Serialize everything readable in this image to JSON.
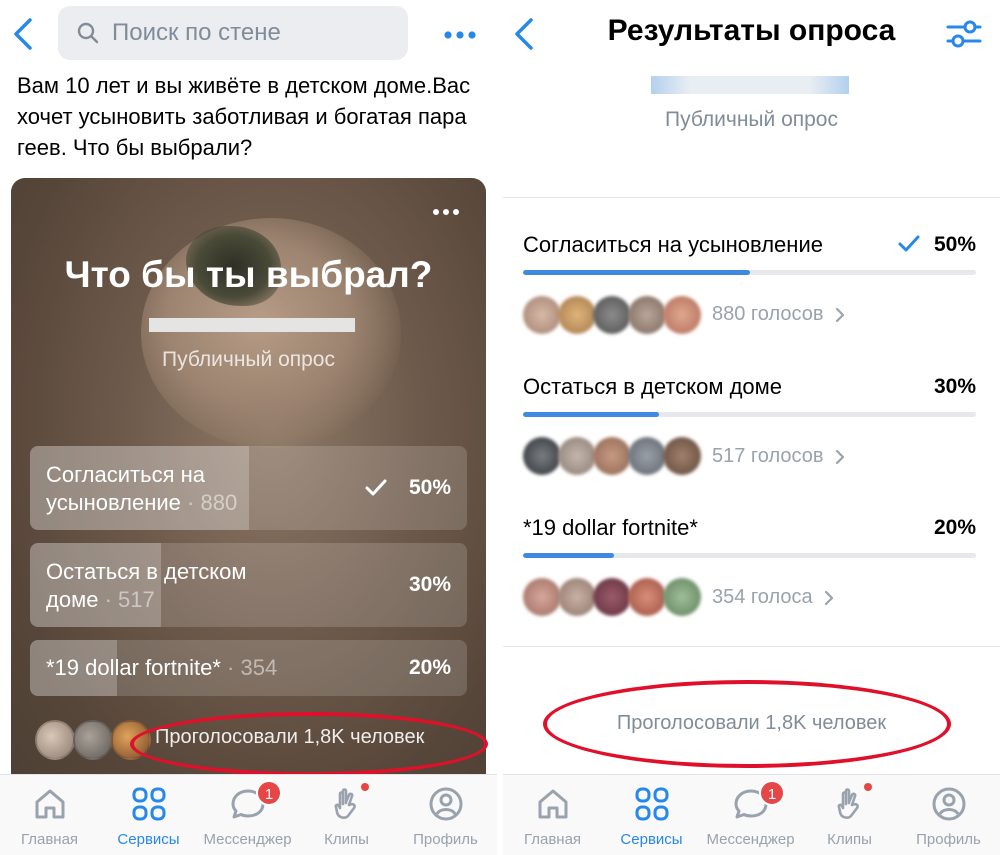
{
  "left_screen": {
    "search": {
      "placeholder": "Поиск по стене"
    },
    "post_text": "Вам 10 лет и вы живёте в детском доме.Вас хочет усыновить заботливая и богатая пара геев. Что бы выбрали?",
    "poll": {
      "title": "Что бы ты выбрал?",
      "type": "Публичный опрос",
      "options": [
        {
          "label": "Согласиться на усыновление",
          "line1": "Согласиться на",
          "line2": "усыновление",
          "count": "880",
          "percent": "50%",
          "share": 0.5,
          "selected": true
        },
        {
          "label": "Остаться в детском доме",
          "line1": "Остаться в детском",
          "line2": "доме",
          "count": "517",
          "percent": "30%",
          "share": 0.3,
          "selected": false
        },
        {
          "label": "*19 dollar fortnite*",
          "count": "354",
          "percent": "20%",
          "share": 0.2,
          "selected": false
        }
      ],
      "voted_total": "Проголосовали 1,8K человек"
    }
  },
  "right_screen": {
    "title": "Результаты опроса",
    "subtitle": "Публичный опрос",
    "options": [
      {
        "label": "Согласиться на усыновление",
        "percent": "50%",
        "share": 0.5,
        "selected": true,
        "votes": "880 голосов"
      },
      {
        "label": "Остаться в детском доме",
        "percent": "30%",
        "share": 0.3,
        "selected": false,
        "votes": "517 голосов"
      },
      {
        "label": "*19 dollar fortnite*",
        "percent": "20%",
        "share": 0.2,
        "selected": false,
        "votes": "354 голоса"
      }
    ],
    "voted_total": "Проголосовали 1,8K человек"
  },
  "tabbar": {
    "items": [
      {
        "label": "Главная",
        "icon": "home-icon",
        "active": false
      },
      {
        "label": "Сервисы",
        "icon": "services-icon",
        "active": true
      },
      {
        "label": "Мессенджер",
        "icon": "messenger-icon",
        "active": false,
        "badge": "1"
      },
      {
        "label": "Клипы",
        "icon": "clips-icon",
        "active": false,
        "dot": true
      },
      {
        "label": "Профиль",
        "icon": "profile-icon",
        "active": false
      }
    ]
  },
  "colors": {
    "accent": "#2688eb",
    "bar_fill": "#3f8ae0",
    "badge": "#e64646",
    "annotation_ellipse": "#e0102a"
  }
}
